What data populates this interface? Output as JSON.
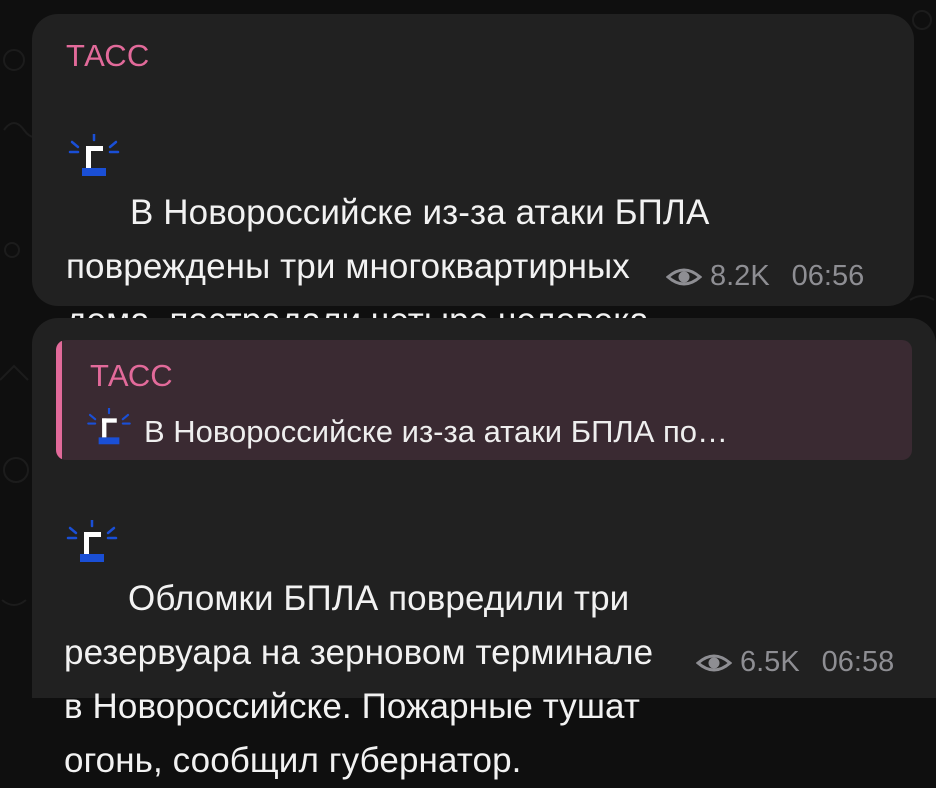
{
  "messages": [
    {
      "sender": "ТАСС",
      "icon": "siren-g-emoji",
      "text": "В Новороссийске из-за атаки БПЛА\nповреждены три многоквартирных\nдома, пострадали четыре человека,\nсообщил губернатор.",
      "views": "8.2K",
      "time": "06:56"
    },
    {
      "reply": {
        "sender": "ТАСС",
        "icon": "siren-g-emoji",
        "text": "В Новороссийске из-за атаки БПЛА по…"
      },
      "sender": null,
      "icon": "siren-g-emoji",
      "text": "Обломки БПЛА повредили три\nрезервуара на зерновом терминале\nв Новороссийске. Пожарные тушат\nогонь, сообщил губернатор.",
      "views": "6.5K",
      "time": "06:58"
    }
  ],
  "colors": {
    "background": "#0f0f0f",
    "bubble": "#212121",
    "sender_accent": "#e26a9a",
    "reply_bg": "#3a2a32",
    "meta_text": "#8e8e93",
    "emoji_blue": "#1a4fd6"
  }
}
